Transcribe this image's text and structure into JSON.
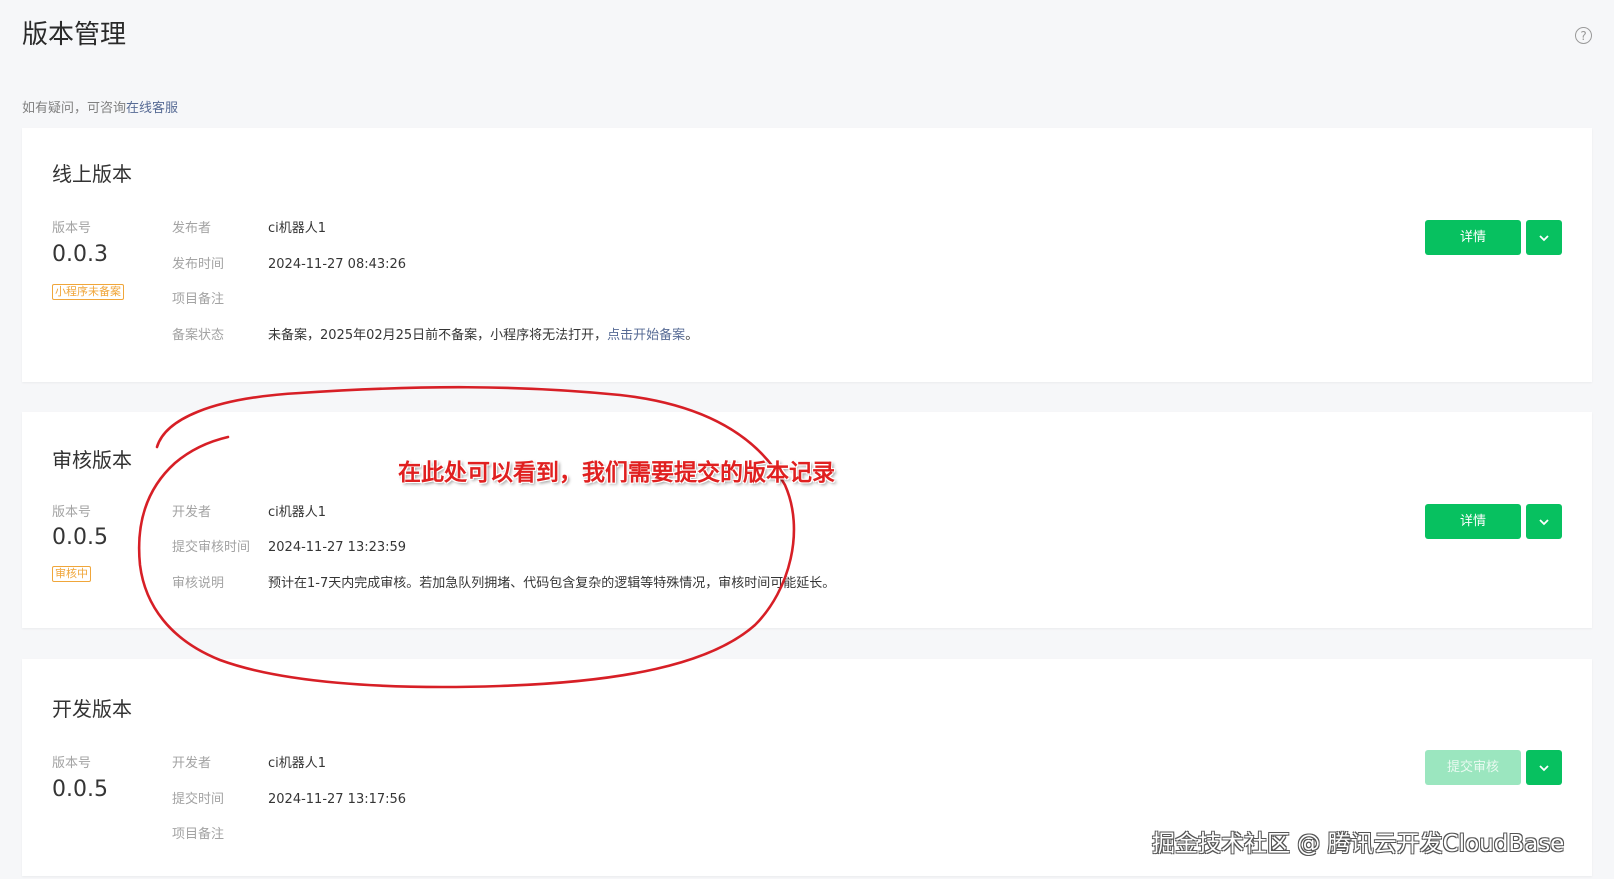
{
  "header": {
    "title": "版本管理",
    "help_icon": "?"
  },
  "notice": {
    "prefix": "如有疑问，可咨询",
    "link": "在线客服"
  },
  "online": {
    "title": "线上版本",
    "version_label": "版本号",
    "version": "0.0.3",
    "tag": "小程序未备案",
    "rows": [
      {
        "k": "发布者",
        "v": "ci机器人1"
      },
      {
        "k": "发布时间",
        "v": "2024-11-27 08:43:26"
      },
      {
        "k": "项目备注",
        "v": ""
      },
      {
        "k": "备案状态",
        "v": "未备案，2025年02月25日前不备案，小程序将无法打开，",
        "link": "点击开始备案",
        "suffix": "。"
      }
    ],
    "btn": "详情"
  },
  "review": {
    "title": "审核版本",
    "version_label": "版本号",
    "version": "0.0.5",
    "tag": "审核中",
    "rows": [
      {
        "k": "开发者",
        "v": "ci机器人1"
      },
      {
        "k": "提交审核时间",
        "v": "2024-11-27 13:23:59"
      },
      {
        "k": "审核说明",
        "v": "预计在1-7天内完成审核。若加急队列拥堵、代码包含复杂的逻辑等特殊情况，审核时间可能延长。"
      }
    ],
    "btn": "详情"
  },
  "dev": {
    "title": "开发版本",
    "version_label": "版本号",
    "version": "0.0.5",
    "rows": [
      {
        "k": "开发者",
        "v": "ci机器人1"
      },
      {
        "k": "提交时间",
        "v": "2024-11-27 13:17:56"
      },
      {
        "k": "项目备注",
        "v": ""
      }
    ],
    "btn": "提交审核"
  },
  "annotation": "在此处可以看到，我们需要提交的版本记录",
  "watermark": "掘金技术社区 @ 腾讯云开发CloudBase",
  "colors": {
    "primary": "#07c160",
    "primary_disabled": "#9be6bf",
    "link": "#576b95",
    "tag": "#f0a63a",
    "annotation": "#e02020"
  }
}
